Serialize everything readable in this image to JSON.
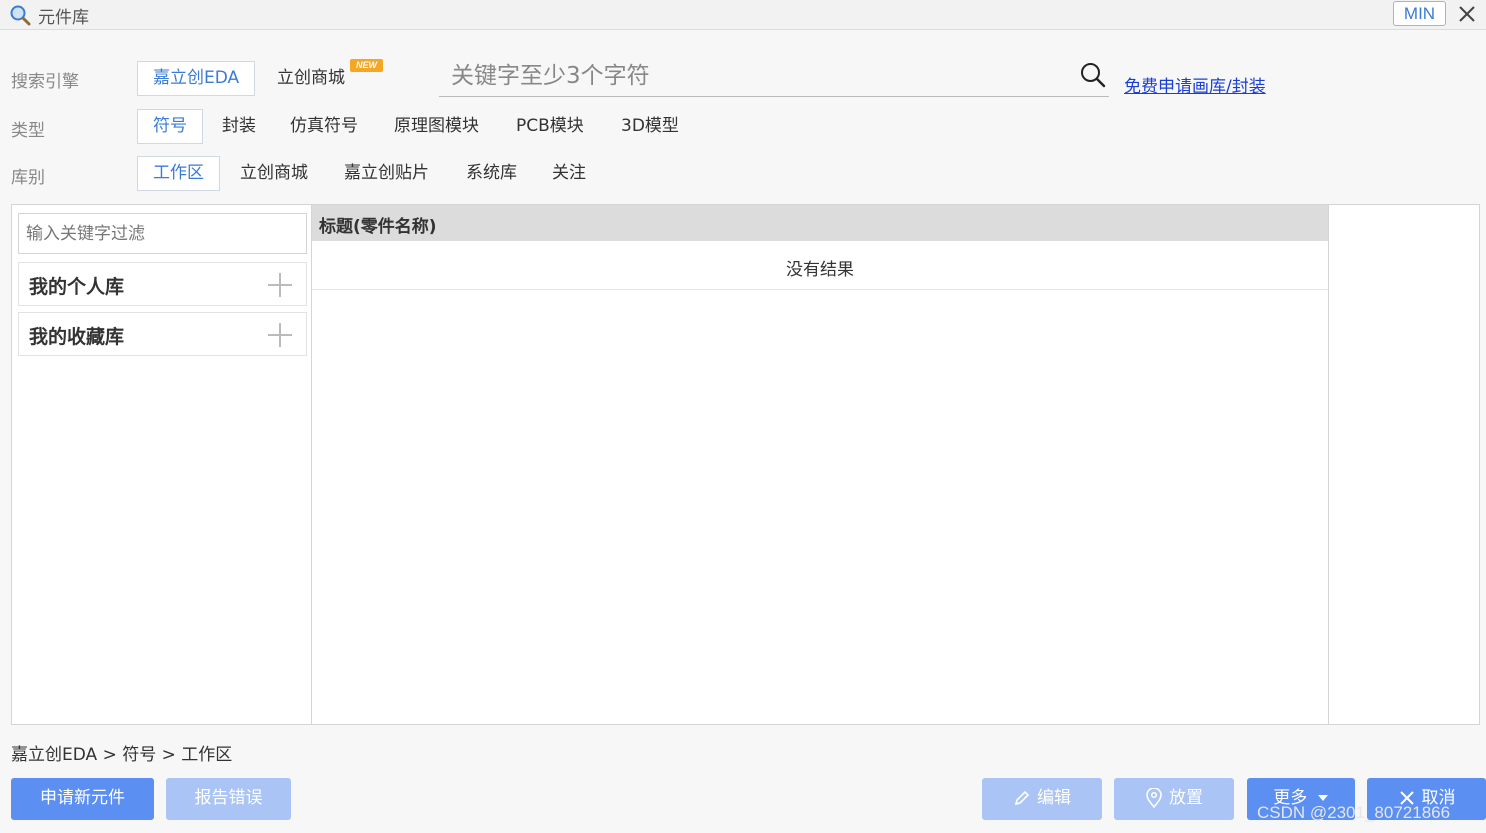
{
  "window": {
    "title": "元件库",
    "min_label": "MIN"
  },
  "search_engine": {
    "label": "搜索引擎",
    "options": [
      "嘉立创EDA",
      "立创商城"
    ],
    "active": "嘉立创EDA",
    "new_badge": "NEW"
  },
  "search": {
    "placeholder": "关键字至少3个字符"
  },
  "apply_link": "免费申请画库/封装",
  "type_row": {
    "label": "类型",
    "options": [
      "符号",
      "封装",
      "仿真符号",
      "原理图模块",
      "PCB模块",
      "3D模型"
    ],
    "active": "符号"
  },
  "library_row": {
    "label": "库别",
    "options": [
      "工作区",
      "立创商城",
      "嘉立创贴片",
      "系统库",
      "关注"
    ],
    "active": "工作区"
  },
  "sidebar": {
    "filter_placeholder": "输入关键字过滤",
    "items": [
      {
        "label": "我的个人库"
      },
      {
        "label": "我的收藏库"
      }
    ]
  },
  "table": {
    "header": "标题(零件名称)",
    "empty_text": "没有结果"
  },
  "breadcrumb": "嘉立创EDA > 符号 > 工作区",
  "buttons": {
    "new_component": "申请新元件",
    "report_error": "报告错误",
    "edit": "编辑",
    "place": "放置",
    "more": "更多",
    "cancel": "取消"
  },
  "watermark": "CSDN @2301_80721866",
  "colors": {
    "accent": "#3a7bd5",
    "primary_button": "#5b8ff2",
    "disabled_button": "#a9c4f5",
    "badge": "#f5a623",
    "link": "#1a3fd6"
  }
}
